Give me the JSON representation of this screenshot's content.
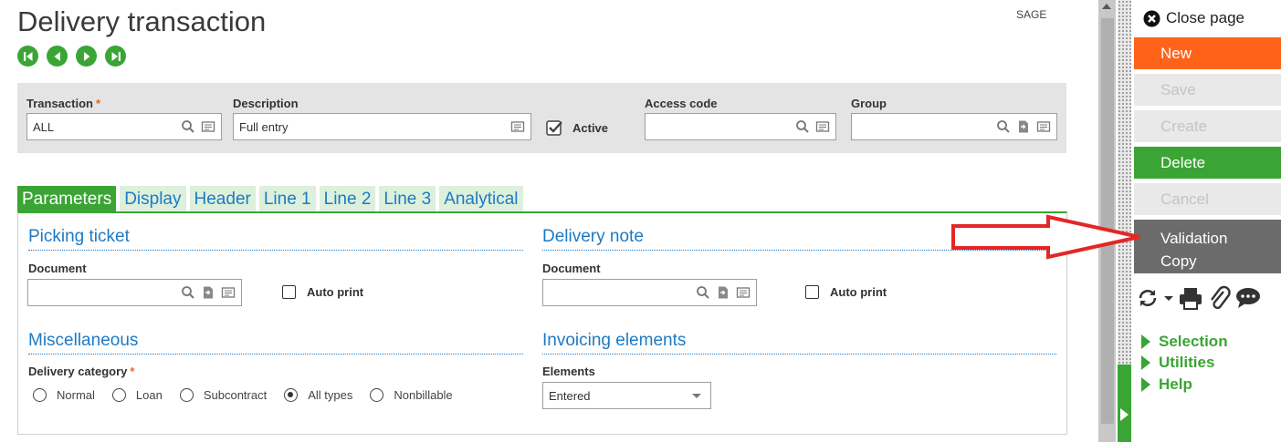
{
  "header": {
    "title": "Delivery transaction",
    "site_label": "SAGE",
    "nav_buttons": [
      "first-record",
      "previous-record",
      "next-record",
      "last-record"
    ]
  },
  "criteria": {
    "transaction": {
      "label": "Transaction",
      "required_mark": "*",
      "value": "ALL"
    },
    "description": {
      "label": "Description",
      "value": "Full entry"
    },
    "active": {
      "label": "Active",
      "checked": true
    },
    "access_code": {
      "label": "Access code",
      "value": ""
    },
    "group": {
      "label": "Group",
      "value": ""
    }
  },
  "tabs": [
    {
      "label": "Parameters",
      "active": true
    },
    {
      "label": "Display",
      "active": false
    },
    {
      "label": "Header",
      "active": false
    },
    {
      "label": "Line 1",
      "active": false
    },
    {
      "label": "Line 2",
      "active": false
    },
    {
      "label": "Line 3",
      "active": false
    },
    {
      "label": "Analytical",
      "active": false
    }
  ],
  "picking_ticket": {
    "title": "Picking ticket",
    "document_label": "Document",
    "document_value": "",
    "auto_print_label": "Auto print",
    "auto_print_checked": false
  },
  "delivery_note": {
    "title": "Delivery note",
    "document_label": "Document",
    "document_value": "",
    "auto_print_label": "Auto print",
    "auto_print_checked": false
  },
  "miscellaneous": {
    "title": "Miscellaneous",
    "category_label": "Delivery category",
    "required_mark": "*",
    "options": [
      "Normal",
      "Loan",
      "Subcontract",
      "All types",
      "Nonbillable"
    ],
    "selected": "All types"
  },
  "invoicing": {
    "title": "Invoicing elements",
    "elements_label": "Elements",
    "elements_value": "Entered"
  },
  "actions": {
    "close_page": "Close page",
    "new": "New",
    "save": "Save",
    "create": "Create",
    "delete": "Delete",
    "cancel": "Cancel",
    "validation_line1": "Validation",
    "validation_line2": "Copy"
  },
  "links": {
    "selection": "Selection",
    "utilities": "Utilities",
    "help": "Help"
  },
  "colors": {
    "accent_green": "#3aa535",
    "new_orange": "#ff6319",
    "link_blue": "#1e7ac4",
    "annotation_red": "#e32626"
  }
}
